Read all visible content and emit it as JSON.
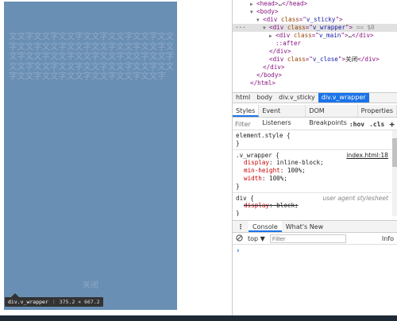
{
  "page": {
    "main_text": "文文字文文字文文字文文字文文字文文字文文字文文字文文字文文字文文字文文字文文字文文字文文字文文字文文字文文字文文字文文字文文字文文字文文字文文字文文字文文字文文字文文字文文字文文字文文字文文字文文字",
    "close_text": "关闭",
    "tooltip_selector": "div.v_wrapper",
    "tooltip_size": "375.2 × 667.2"
  },
  "dom_tree": [
    {
      "indent": 0,
      "tri": "▶",
      "html": "<head>…</head>",
      "parts": [
        [
          "tag",
          "<head>"
        ],
        [
          "txt",
          "…"
        ],
        [
          "tag",
          "</head>"
        ]
      ]
    },
    {
      "indent": 0,
      "tri": "▼",
      "parts": [
        [
          "tag",
          "<body>"
        ]
      ]
    },
    {
      "indent": 1,
      "tri": "▼",
      "parts": [
        [
          "tag",
          "<div "
        ],
        [
          "attr",
          "class"
        ],
        [
          "tag",
          "=\""
        ],
        [
          "val",
          "v_sticky"
        ],
        [
          "tag",
          "\">"
        ]
      ]
    },
    {
      "indent": 2,
      "tri": "▼",
      "selected": true,
      "parts": [
        [
          "tag",
          "<div "
        ],
        [
          "attr",
          "class"
        ],
        [
          "tag",
          "=\""
        ],
        [
          "val",
          "v_wrapper"
        ],
        [
          "tag",
          "\">"
        ],
        [
          "eq0",
          " == $0"
        ]
      ]
    },
    {
      "indent": 3,
      "tri": "▶",
      "parts": [
        [
          "tag",
          "<div "
        ],
        [
          "attr",
          "class"
        ],
        [
          "tag",
          "=\""
        ],
        [
          "val",
          "v_main"
        ],
        [
          "tag",
          "\">"
        ],
        [
          "txt",
          "…"
        ],
        [
          "tag",
          "</div>"
        ]
      ]
    },
    {
      "indent": 3,
      "tri": "",
      "parts": [
        [
          "tag",
          "::after"
        ]
      ]
    },
    {
      "indent": 2,
      "tri": "",
      "parts": [
        [
          "tag",
          "</div>"
        ]
      ]
    },
    {
      "indent": 2,
      "tri": "",
      "parts": [
        [
          "tag",
          "<div "
        ],
        [
          "attr",
          "class"
        ],
        [
          "tag",
          "=\""
        ],
        [
          "val",
          "v_close"
        ],
        [
          "tag",
          "\">"
        ],
        [
          "txt",
          "关闭"
        ],
        [
          "tag",
          "</div>"
        ]
      ]
    },
    {
      "indent": 1,
      "tri": "",
      "parts": [
        [
          "tag",
          "</div>"
        ]
      ]
    },
    {
      "indent": 0,
      "tri": "",
      "parts": [
        [
          "tag",
          "</body>"
        ]
      ]
    },
    {
      "indent": -1,
      "tri": "",
      "parts": [
        [
          "tag",
          "</html>"
        ]
      ]
    }
  ],
  "dom_dots": "···",
  "breadcrumb": [
    "html",
    "body",
    "div.v_sticky",
    "div.v_wrapper"
  ],
  "styles_tabs": [
    "Styles",
    "Event Listeners",
    "DOM Breakpoints",
    "Properties"
  ],
  "filter": {
    "placeholder": "Filter",
    "hov": ":hov",
    "cls": ".cls",
    "plus": "+"
  },
  "rules": {
    "element_style": {
      "selector": "element.style {",
      "close": "}"
    },
    "v_wrapper": {
      "selector": ".v_wrapper {",
      "source": "index.html:18",
      "props": [
        {
          "name": "display",
          "value": "inline-block;"
        },
        {
          "name": "min-height",
          "value": "100%;"
        },
        {
          "name": "width",
          "value": "100%;"
        }
      ],
      "close": "}"
    },
    "div": {
      "selector": "div {",
      "source": "user agent stylesheet",
      "props": [
        {
          "name": "display",
          "value": "block;"
        }
      ],
      "close": "}"
    }
  },
  "console_tabs": {
    "menu": "⋮",
    "console": "Console",
    "whats_new": "What's New"
  },
  "console_toolbar": {
    "context": "top ▼",
    "filter_placeholder": "Filter",
    "levels": "Info"
  },
  "prompt": "›",
  "colors": {
    "wrapper_bg": "#6a8fb4",
    "accent": "#1a73e8",
    "tag": "#881280",
    "attr": "#994500",
    "prop": "#c80000"
  }
}
